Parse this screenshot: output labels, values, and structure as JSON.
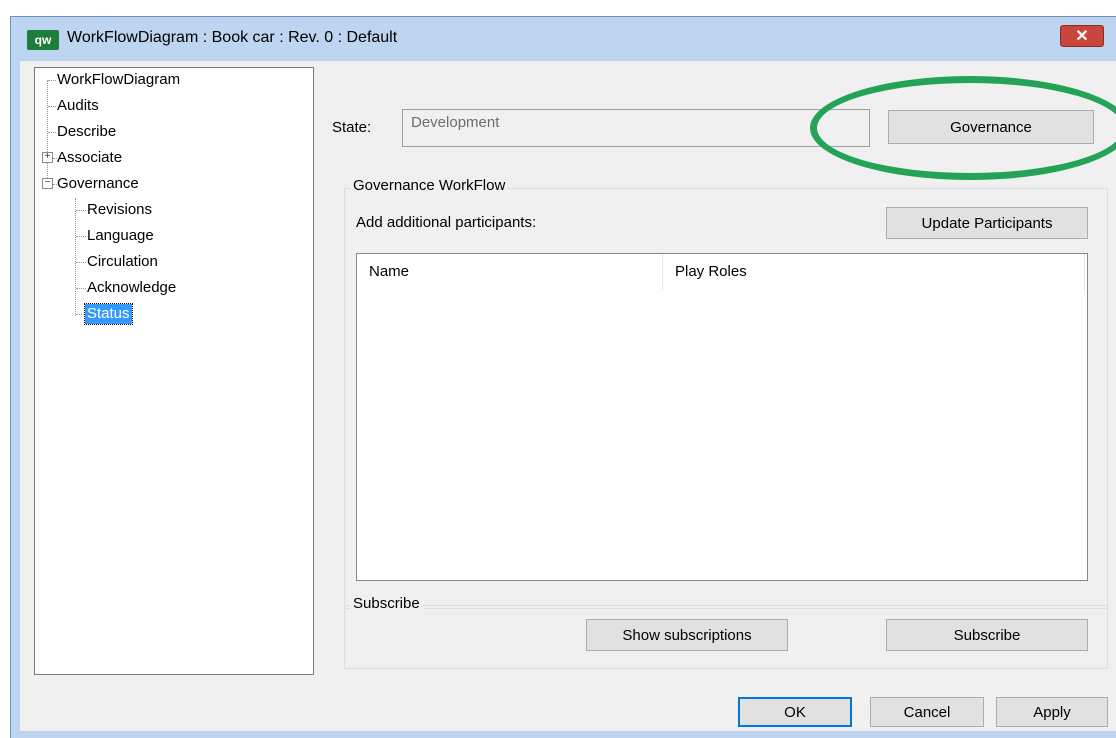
{
  "window": {
    "app_icon": "qw-app-icon",
    "app_icon_text": "qw",
    "title": "WorkFlowDiagram : Book car : Rev. 0  : Default",
    "close_glyph": "✕"
  },
  "tree": {
    "items": [
      {
        "label": "WorkFlowDiagram"
      },
      {
        "label": "Audits"
      },
      {
        "label": "Describe"
      },
      {
        "label": "Associate",
        "expander": "+"
      },
      {
        "label": "Governance",
        "expander": "−"
      },
      {
        "label": "Revisions"
      },
      {
        "label": "Language"
      },
      {
        "label": "Circulation"
      },
      {
        "label": "Acknowledge"
      },
      {
        "label": "Status",
        "selected": true
      }
    ]
  },
  "state": {
    "label": "State:",
    "value": "Development",
    "governance_button": "Governance"
  },
  "workflow": {
    "group_title": "Governance WorkFlow",
    "add_participants_label": "Add additional participants:",
    "update_button": "Update Participants",
    "columns": [
      "Name",
      "Play Roles"
    ]
  },
  "subscribe": {
    "group_title": "Subscribe",
    "show_button": "Show subscriptions",
    "subscribe_button": "Subscribe"
  },
  "footer": {
    "ok": "OK",
    "cancel": "Cancel",
    "apply": "Apply"
  },
  "annotation": {
    "color": "#22a356"
  }
}
